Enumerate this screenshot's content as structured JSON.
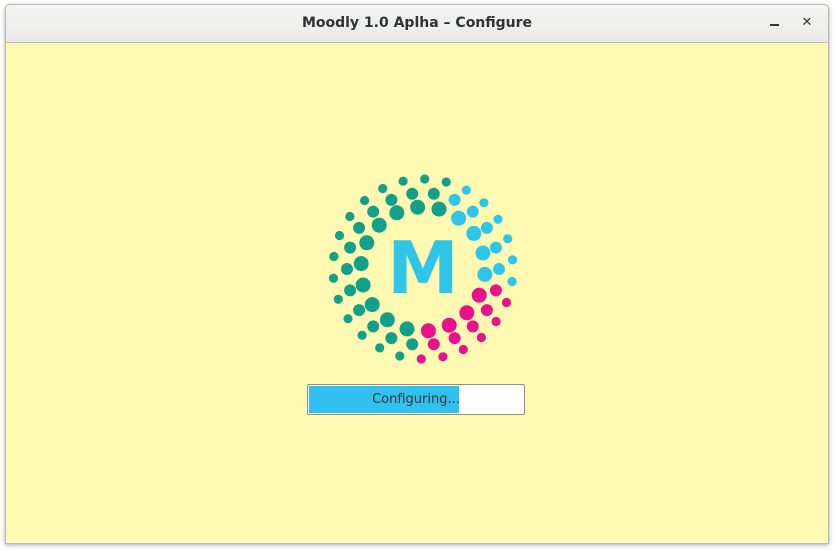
{
  "window": {
    "title": "Moodly 1.0 Aplha – Configure",
    "minimize_glyph": "—",
    "close_glyph": "✕"
  },
  "logo": {
    "letter": "M",
    "icon": "moodly-logo-icon",
    "colors": {
      "cyan": "#2fc5e8",
      "teal": "#12a08a",
      "magenta": "#e8128d",
      "background": "#fff9b1"
    }
  },
  "progress": {
    "label": "Configuring...",
    "fraction": 0.7,
    "fill_color": "#30c1ef"
  }
}
